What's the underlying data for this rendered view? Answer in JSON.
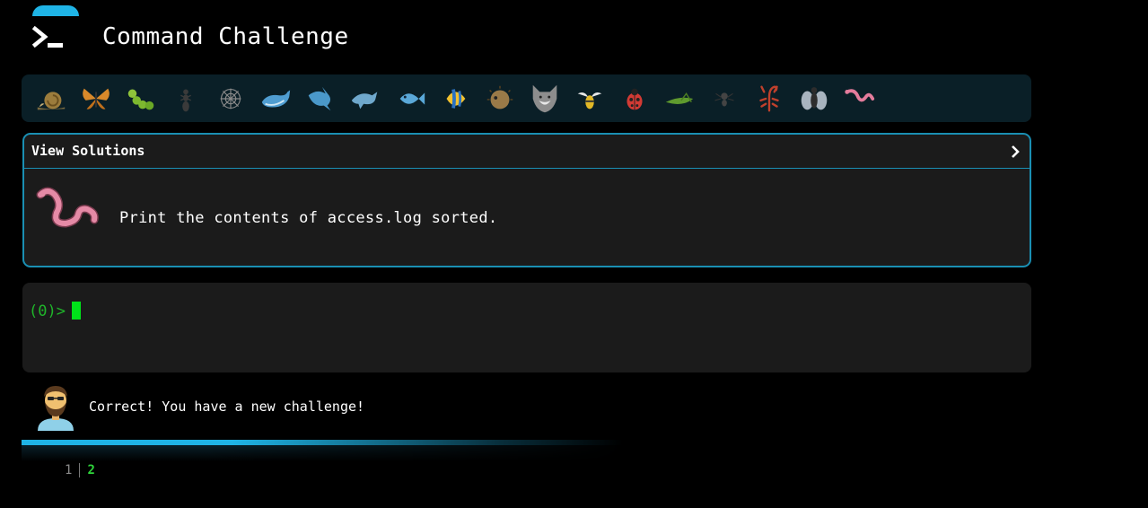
{
  "app": {
    "title": "Command Challenge",
    "accent_color": "#1fb4e6"
  },
  "critters": [
    {
      "name": "snail-icon"
    },
    {
      "name": "butterfly-icon"
    },
    {
      "name": "caterpillar-icon"
    },
    {
      "name": "ant-icon"
    },
    {
      "name": "spider-web-icon"
    },
    {
      "name": "whale-icon"
    },
    {
      "name": "shark-icon"
    },
    {
      "name": "dolphin-icon"
    },
    {
      "name": "fish-icon"
    },
    {
      "name": "tropical-fish-icon"
    },
    {
      "name": "blowfish-icon"
    },
    {
      "name": "wolf-icon"
    },
    {
      "name": "bee-icon"
    },
    {
      "name": "ladybug-icon"
    },
    {
      "name": "cricket-icon"
    },
    {
      "name": "spider-icon"
    },
    {
      "name": "scorpion-icon"
    },
    {
      "name": "fly-icon"
    },
    {
      "name": "worm-icon"
    }
  ],
  "challenge": {
    "solutions_label": "View Solutions",
    "text": "Print the contents of access.log sorted.",
    "icon": "worm-icon"
  },
  "terminal": {
    "prompt": "(0)>",
    "input_value": ""
  },
  "feedback": {
    "message": "Correct! You have a new challenge!",
    "avatar_icon": "bearded-man-avatar"
  },
  "levels": {
    "items": [
      "1",
      "2"
    ],
    "current": "2"
  }
}
